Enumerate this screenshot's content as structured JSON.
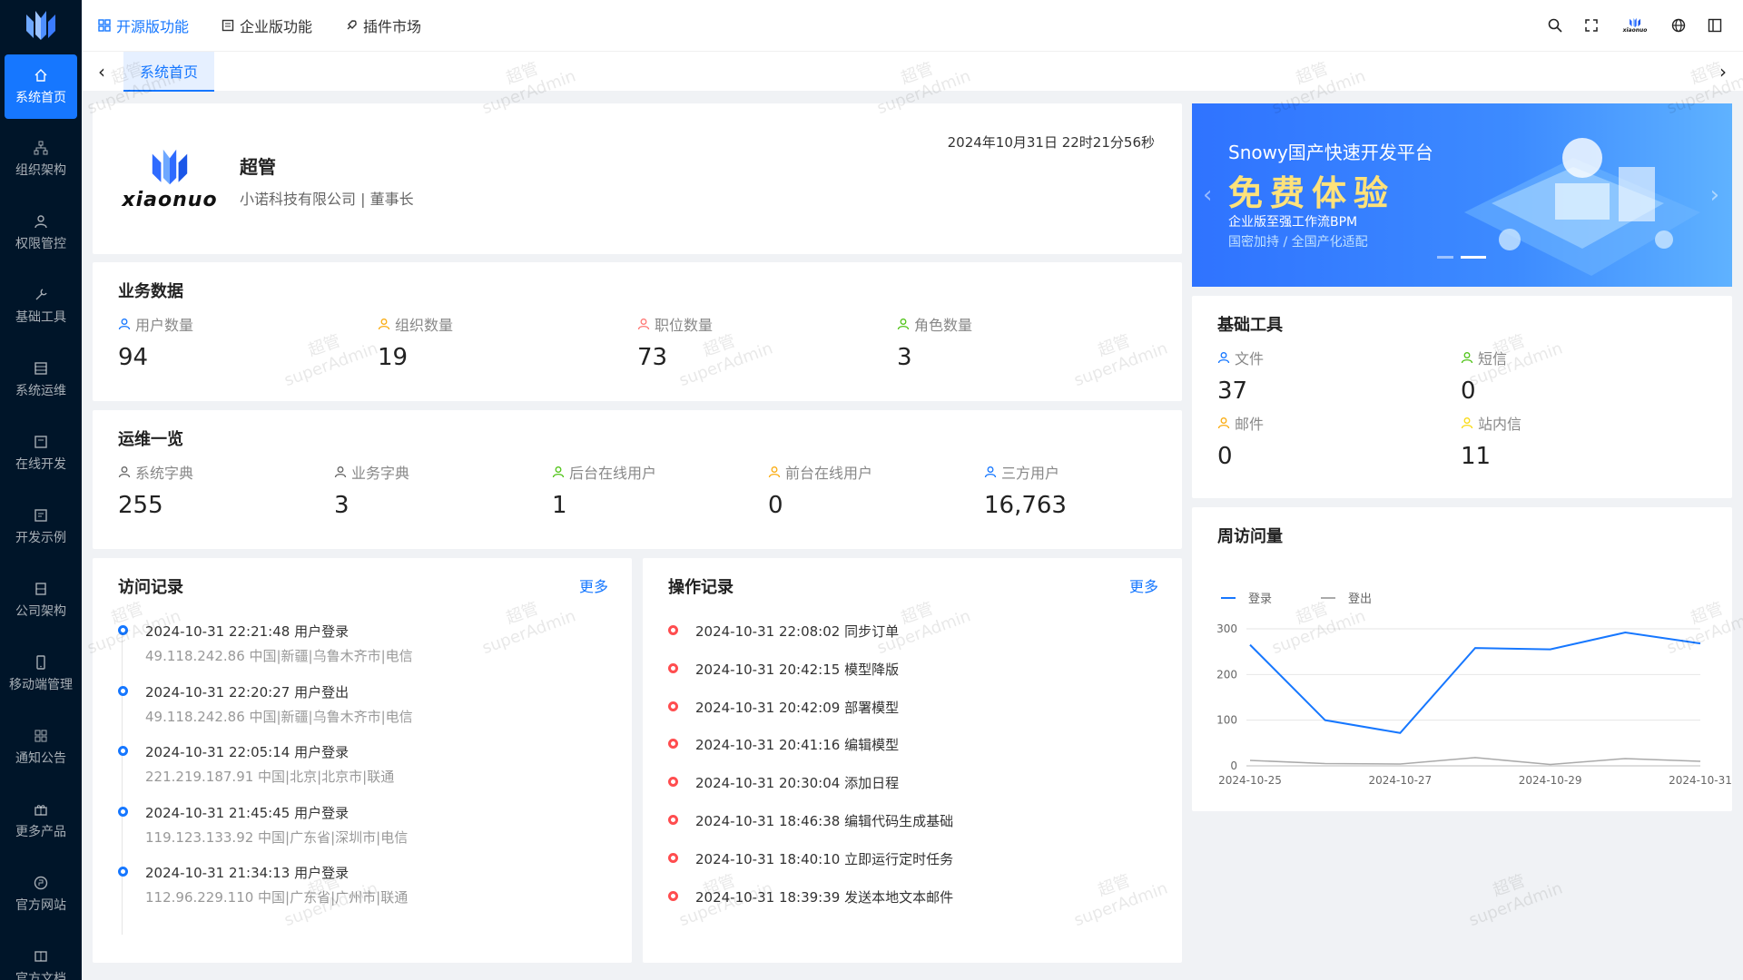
{
  "sidebar": {
    "items": [
      {
        "label": "系统首页",
        "icon": "home-icon"
      },
      {
        "label": "组织架构",
        "icon": "org-icon"
      },
      {
        "label": "权限管控",
        "icon": "user-icon"
      },
      {
        "label": "基础工具",
        "icon": "wrench-icon"
      },
      {
        "label": "系统运维",
        "icon": "server-icon"
      },
      {
        "label": "在线开发",
        "icon": "code-icon"
      },
      {
        "label": "开发示例",
        "icon": "example-icon"
      },
      {
        "label": "公司架构",
        "icon": "building-icon"
      },
      {
        "label": "移动端管理",
        "icon": "mobile-icon"
      },
      {
        "label": "通知公告",
        "icon": "grid-icon"
      },
      {
        "label": "更多产品",
        "icon": "gift-icon"
      },
      {
        "label": "官方网站",
        "icon": "globe-icon"
      },
      {
        "label": "官方文档",
        "icon": "book-icon"
      }
    ]
  },
  "topbar": {
    "tabs": [
      {
        "label": "开源版功能"
      },
      {
        "label": "企业版功能"
      },
      {
        "label": "插件市场"
      }
    ],
    "user_logo_text": "xiaonuo"
  },
  "page_tabs": {
    "current": "系统首页"
  },
  "profile": {
    "name": "超管",
    "org": "小诺科技有限公司 | 董事长",
    "datetime": "2024年10月31日 22时21分56秒",
    "logo_text": "xiaonuo"
  },
  "business": {
    "title": "业务数据",
    "stats": [
      {
        "label": "用户数量",
        "value": "94",
        "color": "#1677ff"
      },
      {
        "label": "组织数量",
        "value": "19",
        "color": "#faad14"
      },
      {
        "label": "职位数量",
        "value": "73",
        "color": "#ff7875"
      },
      {
        "label": "角色数量",
        "value": "3",
        "color": "#52c41a"
      }
    ]
  },
  "ops": {
    "title": "运维一览",
    "stats": [
      {
        "label": "系统字典",
        "value": "255",
        "color": "#666666"
      },
      {
        "label": "业务字典",
        "value": "3",
        "color": "#666666"
      },
      {
        "label": "后台在线用户",
        "value": "1",
        "color": "#52c41a"
      },
      {
        "label": "前台在线用户",
        "value": "0",
        "color": "#faad14"
      },
      {
        "label": "三方用户",
        "value": "16,763",
        "color": "#1677ff"
      }
    ]
  },
  "visit_log": {
    "title": "访问记录",
    "more": "更多",
    "items": [
      {
        "text": "2024-10-31 22:21:48 用户登录",
        "sub": "49.118.242.86 中国|新疆|乌鲁木齐市|电信"
      },
      {
        "text": "2024-10-31 22:20:27 用户登出",
        "sub": "49.118.242.86 中国|新疆|乌鲁木齐市|电信"
      },
      {
        "text": "2024-10-31 22:05:14 用户登录",
        "sub": "221.219.187.91 中国|北京|北京市|联通"
      },
      {
        "text": "2024-10-31 21:45:45 用户登录",
        "sub": "119.123.133.92 中国|广东省|深圳市|电信"
      },
      {
        "text": "2024-10-31 21:34:13 用户登录",
        "sub": "112.96.229.110 中国|广东省|广州市|联通"
      }
    ]
  },
  "op_log": {
    "title": "操作记录",
    "more": "更多",
    "items": [
      {
        "text": "2024-10-31 22:08:02 同步订单"
      },
      {
        "text": "2024-10-31 20:42:15 模型降版"
      },
      {
        "text": "2024-10-31 20:42:09 部署模型"
      },
      {
        "text": "2024-10-31 20:41:16 编辑模型"
      },
      {
        "text": "2024-10-31 20:30:04 添加日程"
      },
      {
        "text": "2024-10-31 18:46:38 编辑代码生成基础"
      },
      {
        "text": "2024-10-31 18:40:10 立即运行定时任务"
      },
      {
        "text": "2024-10-31 18:39:39 发送本地文本邮件"
      }
    ]
  },
  "banner": {
    "line1": "Snowy国产快速开发平台",
    "line2": "免费体验",
    "line3": "企业版至强工作流BPM",
    "line4": "国密加持 / 全国产化适配"
  },
  "tools": {
    "title": "基础工具",
    "items": [
      {
        "label": "文件",
        "value": "37",
        "color": "#1677ff"
      },
      {
        "label": "短信",
        "value": "0",
        "color": "#52c41a"
      },
      {
        "label": "邮件",
        "value": "0",
        "color": "#faad14"
      },
      {
        "label": "站内信",
        "value": "11",
        "color": "#fadb14"
      }
    ]
  },
  "weekly": {
    "title": "周访问量"
  },
  "watermark": {
    "line1": "超管",
    "line2": "superAdmin"
  },
  "chart_data": {
    "type": "line",
    "title": "周访问量",
    "x": [
      "2024-10-25",
      "2024-10-26",
      "2024-10-27",
      "2024-10-28",
      "2024-10-29",
      "2024-10-30",
      "2024-10-31"
    ],
    "x_tick_labels": [
      "2024-10-25",
      "2024-10-27",
      "2024-10-29",
      "2024-10-31"
    ],
    "series": [
      {
        "name": "登录",
        "color": "#1677ff",
        "values": [
          265,
          100,
          72,
          258,
          255,
          292,
          268
        ]
      },
      {
        "name": "登出",
        "color": "#aaaaaa",
        "values": [
          12,
          5,
          4,
          18,
          3,
          16,
          10
        ]
      }
    ],
    "ylim": [
      0,
      300
    ],
    "yticks": [
      0,
      100,
      200,
      300
    ],
    "legend": "top-left",
    "grid": true
  }
}
